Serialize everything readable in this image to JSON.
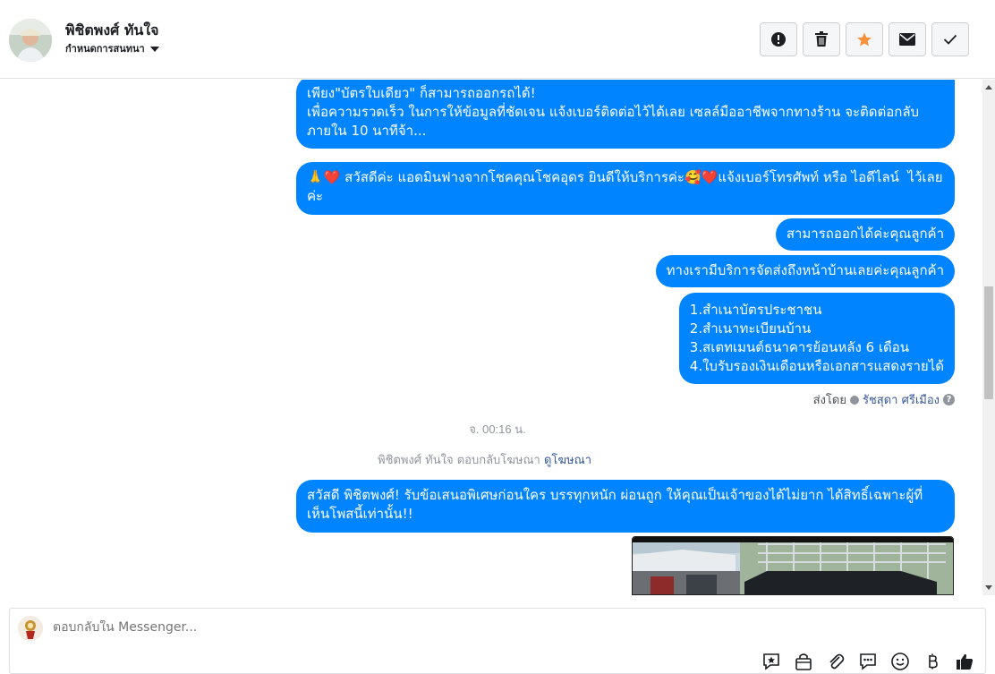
{
  "header": {
    "contact_name": "พิชิตพงศ์ ทันใจ",
    "assign_label": "กำหนดการสนทนา",
    "actions": [
      "report-icon",
      "trash-icon",
      "star-icon",
      "envelope-icon",
      "check-icon"
    ],
    "star_color": "#f7923b"
  },
  "messages": {
    "m1": "เพียง\"บัตรใบเดียว\" ก็สามารถออกรถได้!\nเพื่อความรวดเร็ว ในการให้ข้อมูลที่ชัดเจน แจ้งเบอร์ติดต่อไว้ได้เลย เซลล์มืออาชีพจากทางร้าน จะติดต่อกลับภายใน 10 นาทีจ้า...",
    "m2": "🙏❤️ สวัสดีค่ะ แอดมินฟางจากโชคคุณโชคอุดร ยินดีให้บริการค่ะ🥰❤️แจ้งเบอร์โทรศัพท์ หรือ ไอดีไลน์  ไว้เลยค่ะ",
    "m3": "สามารถออกได้ค่ะคุณลูกค้า",
    "m4": "ทางเรามีบริการจัดส่งถึงหน้าบ้านเลยค่ะคุณลูกค้า",
    "m5": "1.สำเนาบัตรประชาชน\n2.สำเนาทะเบียนบ้าน\n3.สเตทเมนต์ธนาคารย้อนหลัง 6 เดือน\n4.ใบรับรองเงินเดือนหรือเอกสารแสดงรายได้",
    "m6": "สวัสดี พิชิตพงศ์! รับข้อเสนอพิเศษก่อนใคร บรรทุกหนัก ผ่อนถูก ให้คุณเป็นเจ้าของได้ไม่ยาก ได้สิทธิ์เฉพาะผู้ที่เห็นโพสนี้เท่านั้น!!"
  },
  "sent_by": {
    "prefix": "ส่งโดย",
    "sender": "รัชสุดา ศรีเมือง"
  },
  "timestamp": "จ. 00:16 น.",
  "ad_reply": {
    "text": "พิชิตพงศ์ ทันใจ ตอบกลับโฆษณา",
    "link": "ดูโฆษณา"
  },
  "composer": {
    "placeholder": "ตอบกลับใน Messenger...",
    "tools": [
      "saved-reply-icon",
      "shop-bag-icon",
      "attachment-icon",
      "quick-reply-icon",
      "emoji-icon",
      "baht-icon",
      "like-icon"
    ]
  },
  "colors": {
    "bubble": "#0084ff",
    "link": "#365899"
  }
}
